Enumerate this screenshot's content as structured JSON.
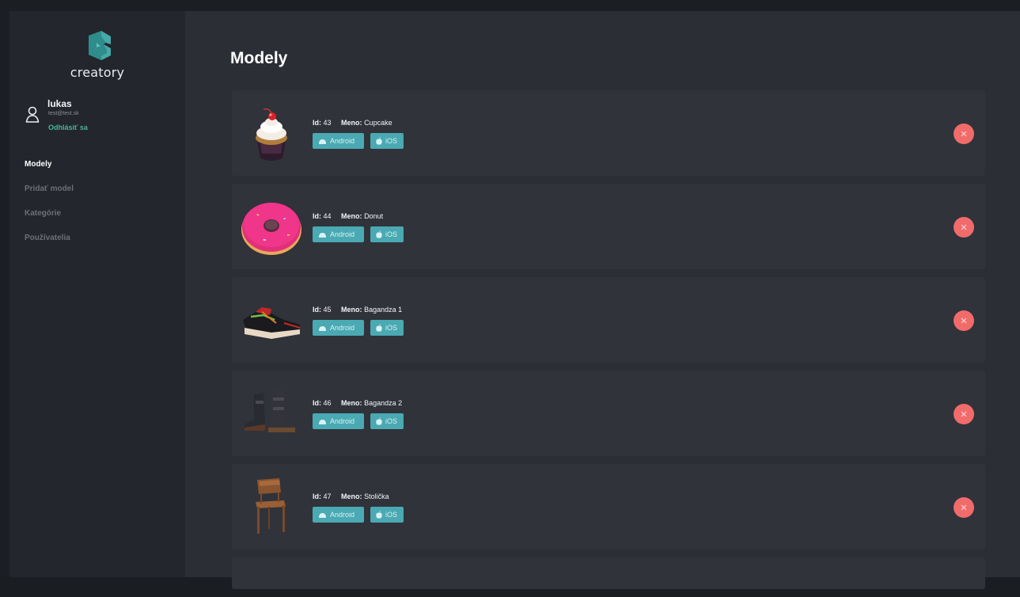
{
  "app": {
    "logo_text": "creatory"
  },
  "user": {
    "name": "lukas",
    "email": "test@test.sk",
    "logout_label": "Odhlásiť sa"
  },
  "nav": {
    "items": [
      {
        "label": "Modely",
        "active": true
      },
      {
        "label": "Pridať model",
        "active": false
      },
      {
        "label": "Kategórie",
        "active": false
      },
      {
        "label": "Používatelia",
        "active": false
      }
    ]
  },
  "page": {
    "title": "Modely"
  },
  "models": [
    {
      "id_label": "Id:",
      "id": "43",
      "name_label": "Meno:",
      "name": "Cupcake",
      "android": "Android",
      "ios": "iOS",
      "thumb": "cupcake-thumbnail"
    },
    {
      "id_label": "Id:",
      "id": "44",
      "name_label": "Meno:",
      "name": "Donut",
      "android": "Android",
      "ios": "iOS",
      "thumb": "donut-thumbnail"
    },
    {
      "id_label": "Id:",
      "id": "45",
      "name_label": "Meno:",
      "name": "Bagandza 1",
      "android": "Android",
      "ios": "iOS",
      "thumb": "sneaker-thumbnail"
    },
    {
      "id_label": "Id:",
      "id": "46",
      "name_label": "Meno:",
      "name": "Bagandza 2",
      "android": "Android",
      "ios": "iOS",
      "thumb": "boots-thumbnail"
    },
    {
      "id_label": "Id:",
      "id": "47",
      "name_label": "Meno:",
      "name": "Stolička",
      "android": "Android",
      "ios": "iOS",
      "thumb": "chair-thumbnail"
    }
  ],
  "colors": {
    "accent_teal": "#4aa9b2",
    "delete_red": "#f16b6b",
    "logout_green": "#48b59f"
  }
}
